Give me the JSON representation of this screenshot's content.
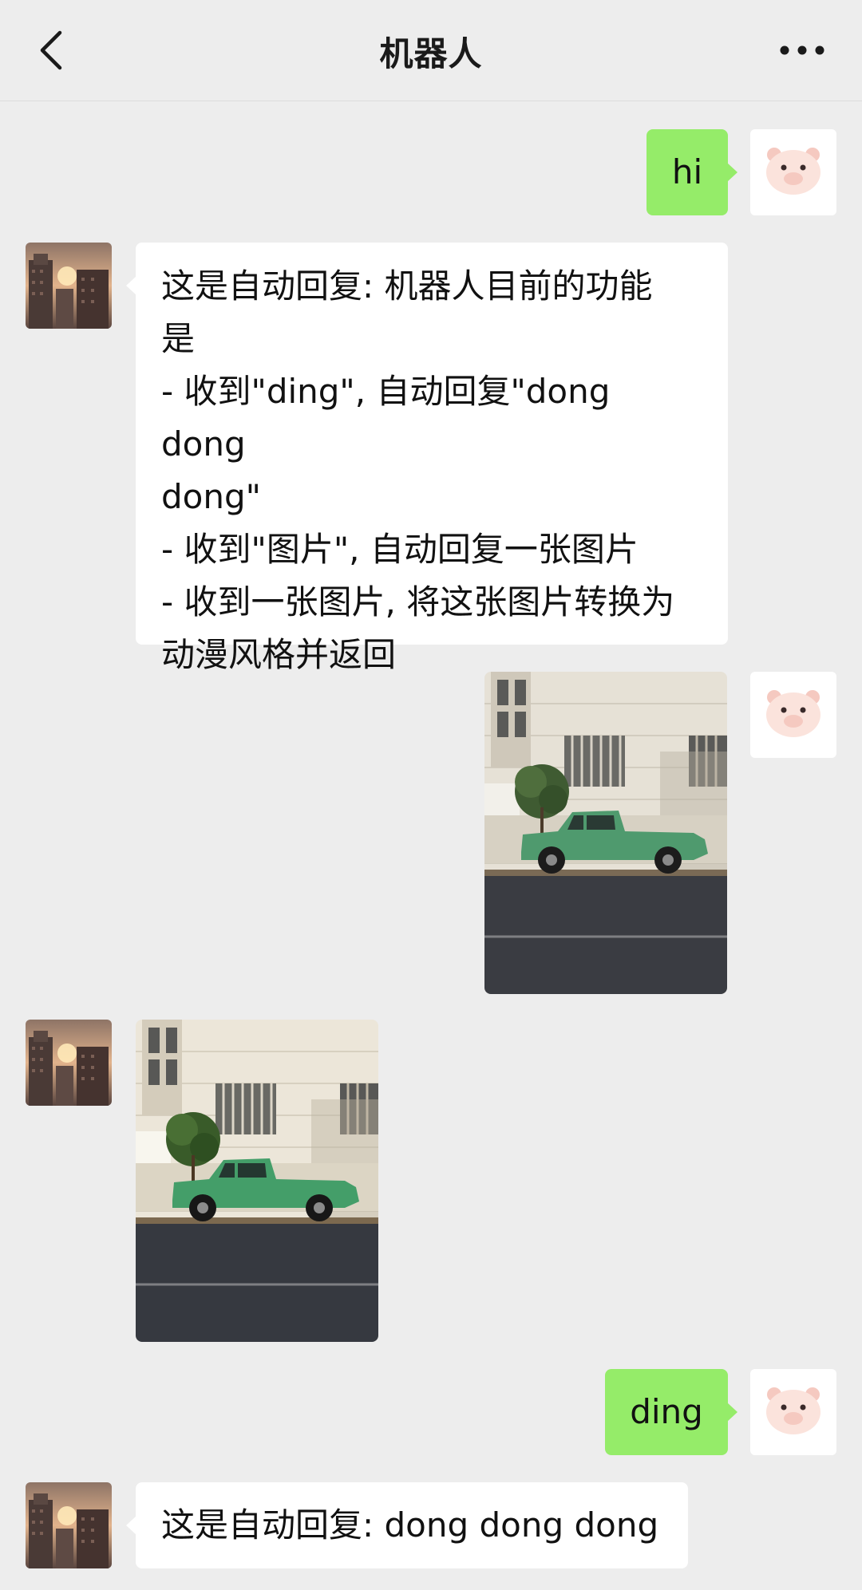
{
  "header": {
    "title": "机器人",
    "back_icon": "chevron-left-icon",
    "more_icon": "more-dots-icon"
  },
  "messages": [
    {
      "sender": "me",
      "type": "text",
      "text": "hi"
    },
    {
      "sender": "bot",
      "type": "text",
      "text": "这是自动回复: 机器人目前的功能\n是\n- 收到\"ding\", 自动回复\"dong dong\ndong\"\n- 收到\"图片\", 自动回复一张图片\n- 收到一张图片, 将这张图片转换为\n动漫风格并返回"
    },
    {
      "sender": "me",
      "type": "image",
      "image": "photo of green pickup truck parked on street"
    },
    {
      "sender": "bot",
      "type": "image",
      "image": "anime-style photo of green pickup truck parked on street"
    },
    {
      "sender": "me",
      "type": "text",
      "text": "ding"
    },
    {
      "sender": "bot",
      "type": "text",
      "text": "这是自动回复: dong dong dong"
    }
  ],
  "avatars": {
    "me": "pig-face-avatar",
    "bot": "city-sunset-avatar"
  },
  "colors": {
    "background": "#ededed",
    "my_bubble": "#95ec69",
    "bot_bubble": "#ffffff",
    "text": "#111111"
  }
}
